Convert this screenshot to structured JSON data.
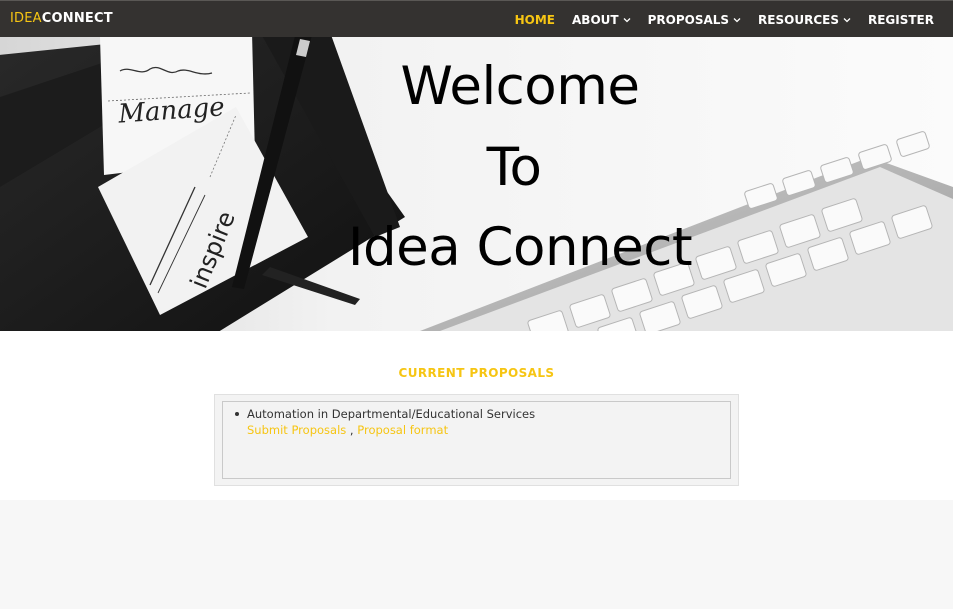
{
  "brand": {
    "part1": "IDEA",
    "part2": "CONNECT"
  },
  "nav": {
    "items": [
      {
        "label": "HOME",
        "active": true,
        "dropdown": false
      },
      {
        "label": "ABOUT",
        "active": false,
        "dropdown": true
      },
      {
        "label": "PROPOSALS",
        "active": false,
        "dropdown": true
      },
      {
        "label": "RESOURCES",
        "active": false,
        "dropdown": true
      },
      {
        "label": "REGISTER",
        "active": false,
        "dropdown": false
      }
    ]
  },
  "hero": {
    "lines": [
      "Welcome",
      "To",
      "Idea Connect"
    ],
    "art_notes": [
      "Manage",
      "inspire"
    ]
  },
  "proposals": {
    "heading": "CURRENT PROPOSALS",
    "items": [
      {
        "title": "Automation in Departmental/Educational Services",
        "links": [
          "Submit Proposals",
          "Proposal format"
        ],
        "separator": ","
      }
    ]
  },
  "colors": {
    "accent": "#f6c513",
    "navbar": "#343230",
    "text": "#333333"
  },
  "icons": {
    "dropdown": "chevron-down-icon"
  }
}
